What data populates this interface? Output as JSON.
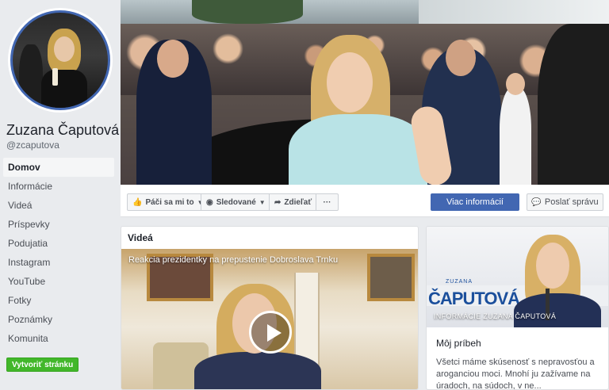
{
  "page": {
    "name": "Zuzana Čaputová",
    "handle": "@zcaputova",
    "verified_mark": "✔"
  },
  "sidebar": {
    "items": [
      {
        "label": "Domov",
        "active": true
      },
      {
        "label": "Informácie"
      },
      {
        "label": "Videá"
      },
      {
        "label": "Príspevky"
      },
      {
        "label": "Podujatia"
      },
      {
        "label": "Instagram"
      },
      {
        "label": "YouTube"
      },
      {
        "label": "Fotky"
      },
      {
        "label": "Poznámky"
      },
      {
        "label": "Komunita"
      }
    ],
    "create_page": "Vytvoriť stránku"
  },
  "actions": {
    "like": "Páči sa mi to",
    "follow": "Sledované",
    "share": "Zdieľať",
    "more": "···",
    "info": "Viac informácií",
    "message": "Poslať správu"
  },
  "videos": {
    "title": "Videá",
    "caption": "Reakcia prezidentky na prepustenie Dobroslava Trnku"
  },
  "story": {
    "small_name": "ZUZANA",
    "big_name": "ČAPUTOVÁ",
    "label": "INFORMÁCIE ZUZANA ČAPUTOVÁ",
    "title": "Môj príbeh",
    "text": "Všetci máme skúsenosť s nepravosťou a aroganciou moci. Mnohí ju zažívame na úradoch, na súdoch, v ne..."
  },
  "colors": {
    "accent": "#4267b2",
    "verified": "#4080ff",
    "create_button": "#42b72a"
  }
}
